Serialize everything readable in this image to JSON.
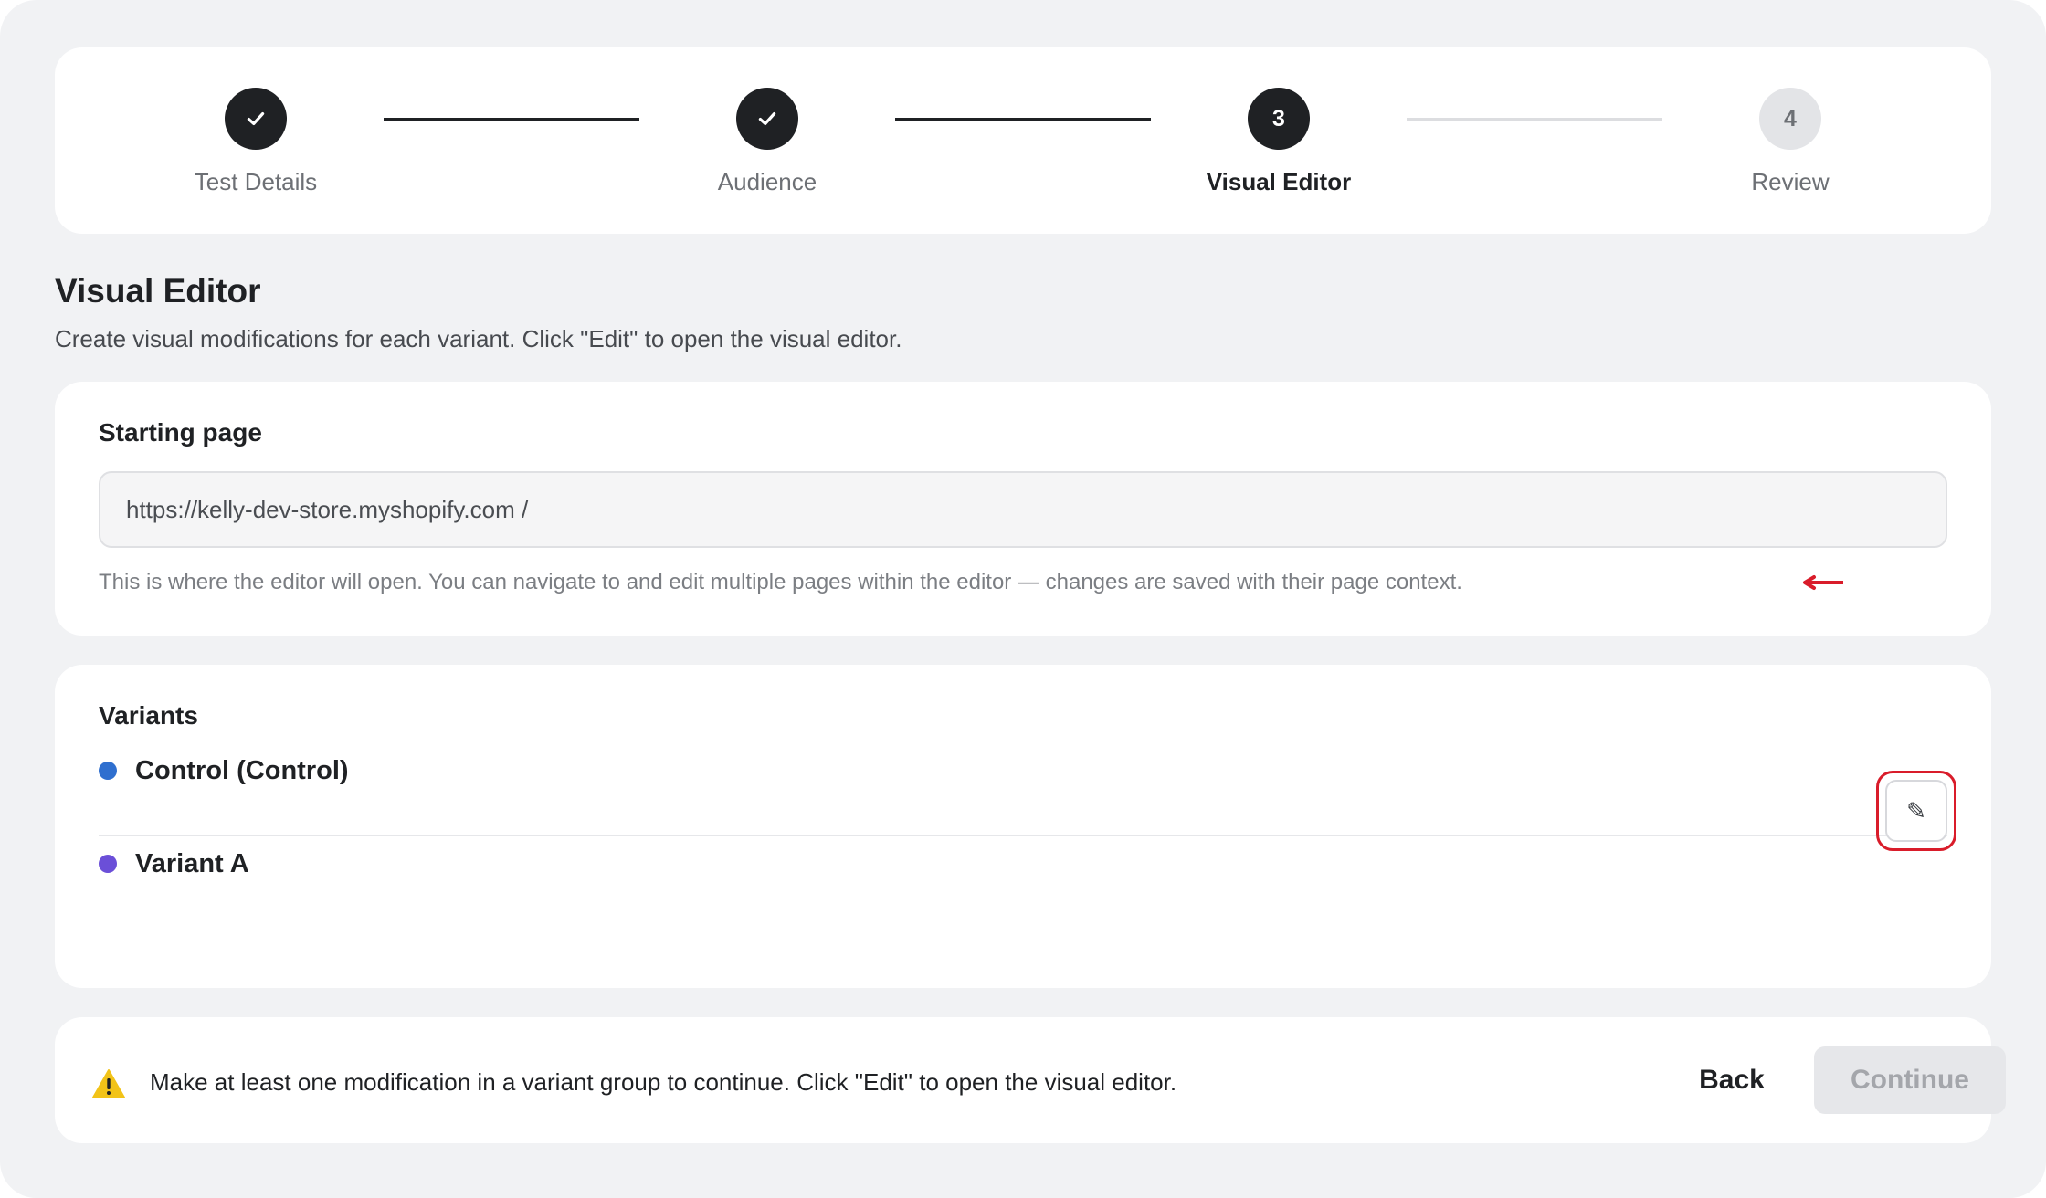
{
  "stepper": {
    "steps": [
      {
        "label": "Test Details",
        "marker": "",
        "state": "complete",
        "icon": "checkmark-icon"
      },
      {
        "label": "Audience",
        "marker": "",
        "state": "complete",
        "icon": "checkmark-icon"
      },
      {
        "label": "Visual Editor",
        "marker": "3",
        "state": "active"
      },
      {
        "label": "Review",
        "marker": "4",
        "state": "pending"
      }
    ]
  },
  "header": {
    "title": "Visual Editor",
    "subtitle": "Create visual modifications for each variant. Click \"Edit\" to open the visual editor."
  },
  "starting_page": {
    "title": "Starting page",
    "url_value": "https://kelly-dev-store.myshopify.com /",
    "help_text": "This is where the editor will open. You can navigate to and edit multiple pages within the editor — changes are saved with their page context."
  },
  "variants": {
    "title": "Variants",
    "items": [
      {
        "name": "Control (Control)",
        "color": "#2f6fcf"
      },
      {
        "name": "Variant A",
        "color": "#6b4fd8"
      }
    ],
    "edit_icon": "pencil-icon",
    "annotation_color": "#d91c2a"
  },
  "footer": {
    "warning_icon": "warning-icon",
    "warning_text": "Make at least one modification in a variant group to continue. Click \"Edit\" to open the visual editor.",
    "back_label": "Back",
    "continue_label": "Continue"
  }
}
